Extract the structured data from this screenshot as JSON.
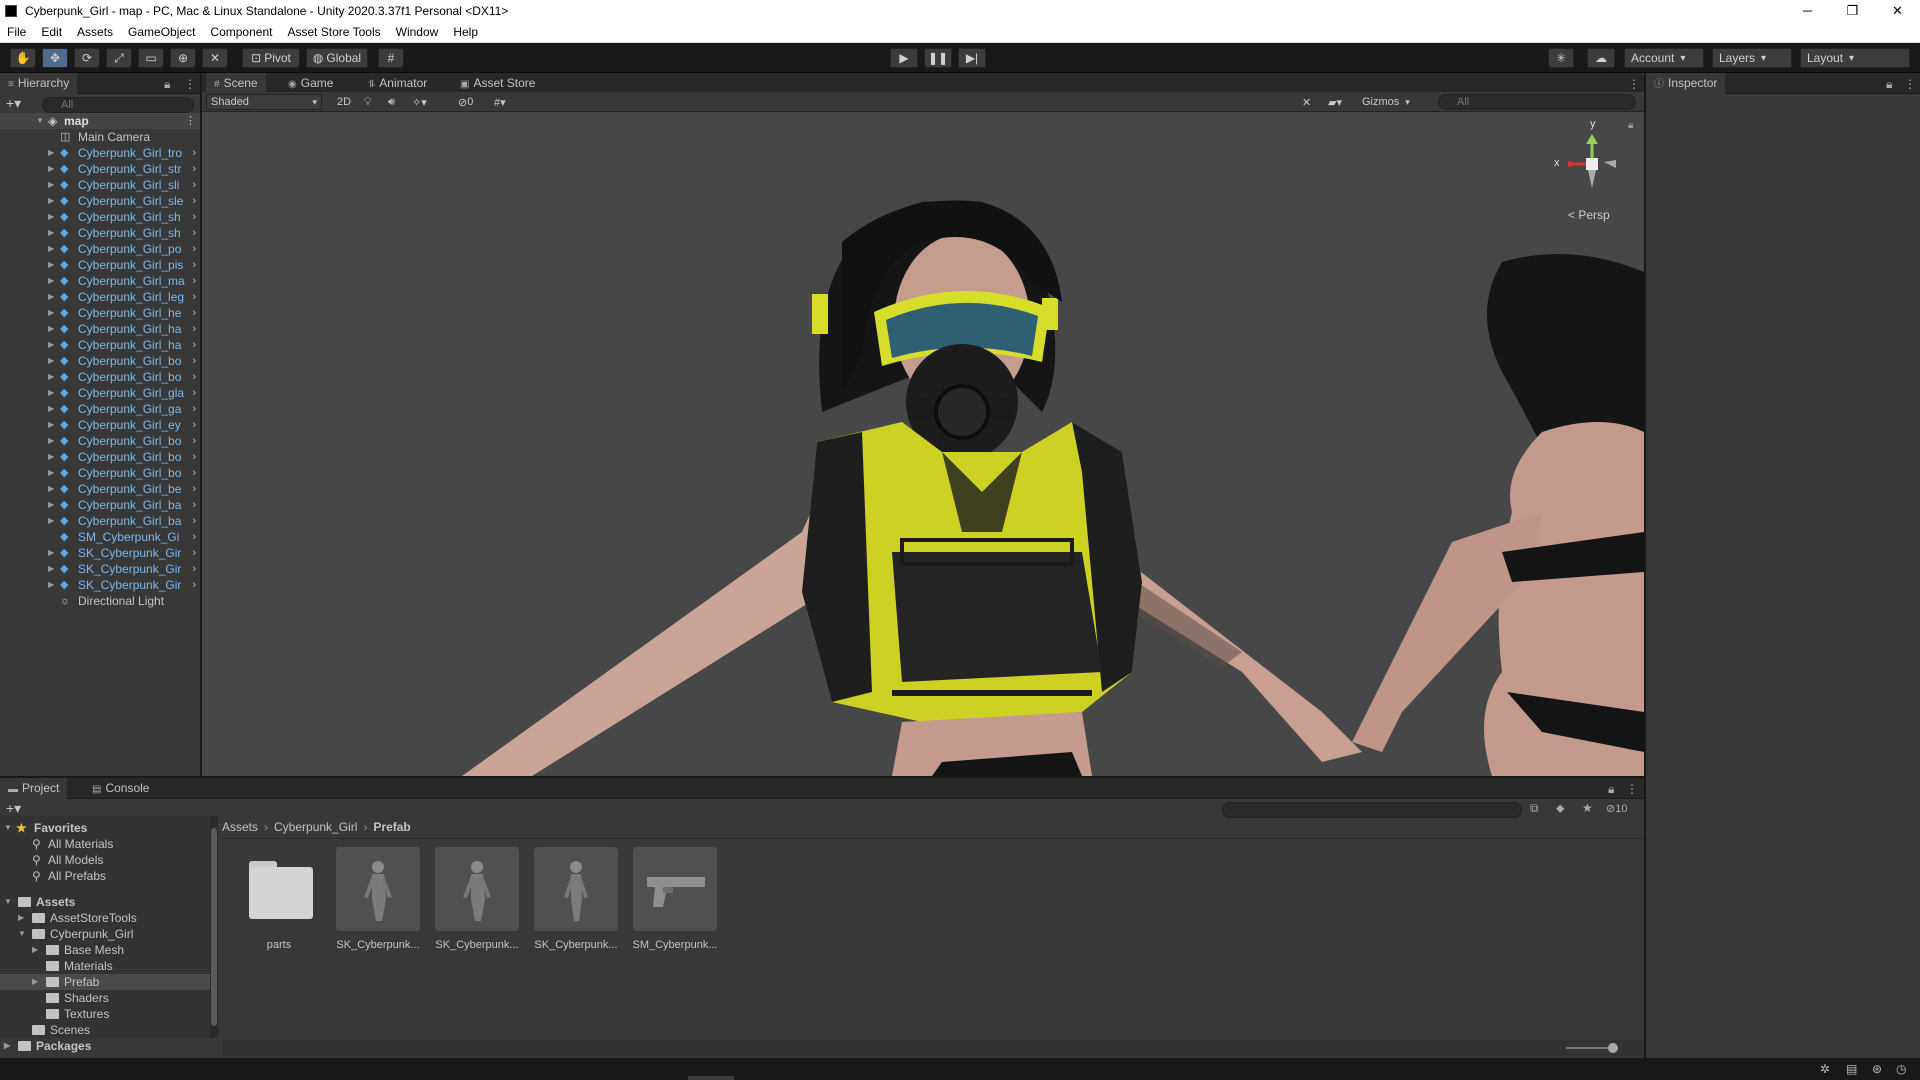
{
  "window": {
    "title": "Cyberpunk_Girl - map - PC, Mac & Linux Standalone - Unity 2020.3.37f1 Personal <DX11>",
    "controls": [
      "─",
      "❐",
      "✕"
    ]
  },
  "menu": [
    "File",
    "Edit",
    "Assets",
    "GameObject",
    "Component",
    "Asset Store Tools",
    "Window",
    "Help"
  ],
  "toolbar": {
    "pivot": "Pivot",
    "global": "Global",
    "account": "Account",
    "layers": "Layers",
    "layout": "Layout"
  },
  "hierarchy": {
    "tab": "Hierarchy",
    "search_placeholder": "All",
    "scene": "map",
    "items": [
      {
        "name": "Main Camera",
        "icon": "camera-icon",
        "color": "normal",
        "expandable": false
      },
      {
        "name": "Cyberpunk_Girl_tro",
        "icon": "prefab-cube-icon",
        "color": "blue",
        "expandable": true
      },
      {
        "name": "Cyberpunk_Girl_str",
        "icon": "prefab-cube-icon",
        "color": "blue",
        "expandable": true
      },
      {
        "name": "Cyberpunk_Girl_sli",
        "icon": "prefab-cube-icon",
        "color": "blue",
        "expandable": true
      },
      {
        "name": "Cyberpunk_Girl_sle",
        "icon": "prefab-cube-icon",
        "color": "blue",
        "expandable": true
      },
      {
        "name": "Cyberpunk_Girl_sh",
        "icon": "prefab-cube-icon",
        "color": "blue",
        "expandable": true
      },
      {
        "name": "Cyberpunk_Girl_sh",
        "icon": "prefab-cube-icon",
        "color": "blue",
        "expandable": true
      },
      {
        "name": "Cyberpunk_Girl_po",
        "icon": "prefab-cube-icon",
        "color": "blue",
        "expandable": true
      },
      {
        "name": "Cyberpunk_Girl_pis",
        "icon": "prefab-cube-icon",
        "color": "blue",
        "expandable": true
      },
      {
        "name": "Cyberpunk_Girl_ma",
        "icon": "prefab-cube-icon",
        "color": "blue",
        "expandable": true
      },
      {
        "name": "Cyberpunk_Girl_leg",
        "icon": "prefab-cube-icon",
        "color": "blue",
        "expandable": true
      },
      {
        "name": "Cyberpunk_Girl_he",
        "icon": "prefab-cube-icon",
        "color": "blue",
        "expandable": true
      },
      {
        "name": "Cyberpunk_Girl_ha",
        "icon": "prefab-cube-icon",
        "color": "blue",
        "expandable": true
      },
      {
        "name": "Cyberpunk_Girl_ha",
        "icon": "prefab-cube-icon",
        "color": "blue",
        "expandable": true
      },
      {
        "name": "Cyberpunk_Girl_bo",
        "icon": "prefab-cube-icon",
        "color": "blue",
        "expandable": true
      },
      {
        "name": "Cyberpunk_Girl_bo",
        "icon": "prefab-cube-icon",
        "color": "blue",
        "expandable": true
      },
      {
        "name": "Cyberpunk_Girl_gla",
        "icon": "prefab-cube-icon",
        "color": "blue",
        "expandable": true
      },
      {
        "name": "Cyberpunk_Girl_ga",
        "icon": "prefab-cube-icon",
        "color": "blue",
        "expandable": true
      },
      {
        "name": "Cyberpunk_Girl_ey",
        "icon": "prefab-cube-icon",
        "color": "blue",
        "expandable": true
      },
      {
        "name": "Cyberpunk_Girl_bo",
        "icon": "prefab-cube-icon",
        "color": "blue",
        "expandable": true
      },
      {
        "name": "Cyberpunk_Girl_bo",
        "icon": "prefab-cube-icon",
        "color": "blue",
        "expandable": true
      },
      {
        "name": "Cyberpunk_Girl_bo",
        "icon": "prefab-cube-icon",
        "color": "blue",
        "expandable": true
      },
      {
        "name": "Cyberpunk_Girl_be",
        "icon": "prefab-cube-icon",
        "color": "blue",
        "expandable": true
      },
      {
        "name": "Cyberpunk_Girl_ba",
        "icon": "prefab-cube-icon",
        "color": "blue",
        "expandable": true
      },
      {
        "name": "Cyberpunk_Girl_ba",
        "icon": "prefab-cube-icon",
        "color": "blue",
        "expandable": true
      },
      {
        "name": "SM_Cyberpunk_Gi",
        "icon": "prefab-cube-icon",
        "color": "blue",
        "expandable": false
      },
      {
        "name": "SK_Cyberpunk_Gir",
        "icon": "prefab-cube-icon",
        "color": "blue",
        "expandable": true
      },
      {
        "name": "SK_Cyberpunk_Gir",
        "icon": "prefab-cube-icon",
        "color": "blue",
        "expandable": true
      },
      {
        "name": "SK_Cyberpunk_Gir",
        "icon": "prefab-cube-icon",
        "color": "blue",
        "expandable": true
      },
      {
        "name": "Directional Light",
        "icon": "light-icon",
        "color": "normal",
        "expandable": false
      }
    ]
  },
  "scene_tabs": [
    {
      "label": "Scene",
      "icon": "#"
    },
    {
      "label": "Game",
      "icon": "◉"
    },
    {
      "label": "Animator",
      "icon": "⥮"
    },
    {
      "label": "Asset Store",
      "icon": "▣"
    }
  ],
  "scene_toolbar": {
    "shading": "Shaded",
    "mode_2d": "2D",
    "hidden_count": "0",
    "gizmos": "Gizmos",
    "search_placeholder": "All"
  },
  "gizmo": {
    "y": "y",
    "x": "x",
    "projection": "Persp"
  },
  "inspector": {
    "tab": "Inspector"
  },
  "bottom_tabs": [
    "Project",
    "Console"
  ],
  "project": {
    "favorites_label": "Favorites",
    "favorites": [
      "All Materials",
      "All Models",
      "All Prefabs"
    ],
    "tree": [
      {
        "label": "Assets",
        "level": 0,
        "bold": true,
        "arrow": "▼"
      },
      {
        "label": "AssetStoreTools",
        "level": 1,
        "bold": false,
        "arrow": "▶"
      },
      {
        "label": "Cyberpunk_Girl",
        "level": 1,
        "bold": false,
        "arrow": "▼"
      },
      {
        "label": "Base Mesh",
        "level": 2,
        "bold": false,
        "arrow": "▶"
      },
      {
        "label": "Materials",
        "level": 2,
        "bold": false,
        "arrow": ""
      },
      {
        "label": "Prefab",
        "level": 2,
        "bold": false,
        "arrow": "▶",
        "selected": true
      },
      {
        "label": "Shaders",
        "level": 2,
        "bold": false,
        "arrow": ""
      },
      {
        "label": "Textures",
        "level": 2,
        "bold": false,
        "arrow": ""
      },
      {
        "label": "Scenes",
        "level": 1,
        "bold": false,
        "arrow": ""
      },
      {
        "label": "Packages",
        "level": 0,
        "bold": true,
        "arrow": "▶"
      }
    ],
    "breadcrumb": [
      "Assets",
      "Cyberpunk_Girl",
      "Prefab"
    ],
    "hidden_count": "10",
    "items": [
      {
        "label": "parts",
        "icon": "folder-icon"
      },
      {
        "label": "SK_Cyberpunk...",
        "icon": "character-thumbnail"
      },
      {
        "label": "SK_Cyberpunk...",
        "icon": "character-thumbnail"
      },
      {
        "label": "SK_Cyberpunk...",
        "icon": "character-thumbnail"
      },
      {
        "label": "SM_Cyberpunk...",
        "icon": "pistol-thumbnail"
      }
    ]
  }
}
